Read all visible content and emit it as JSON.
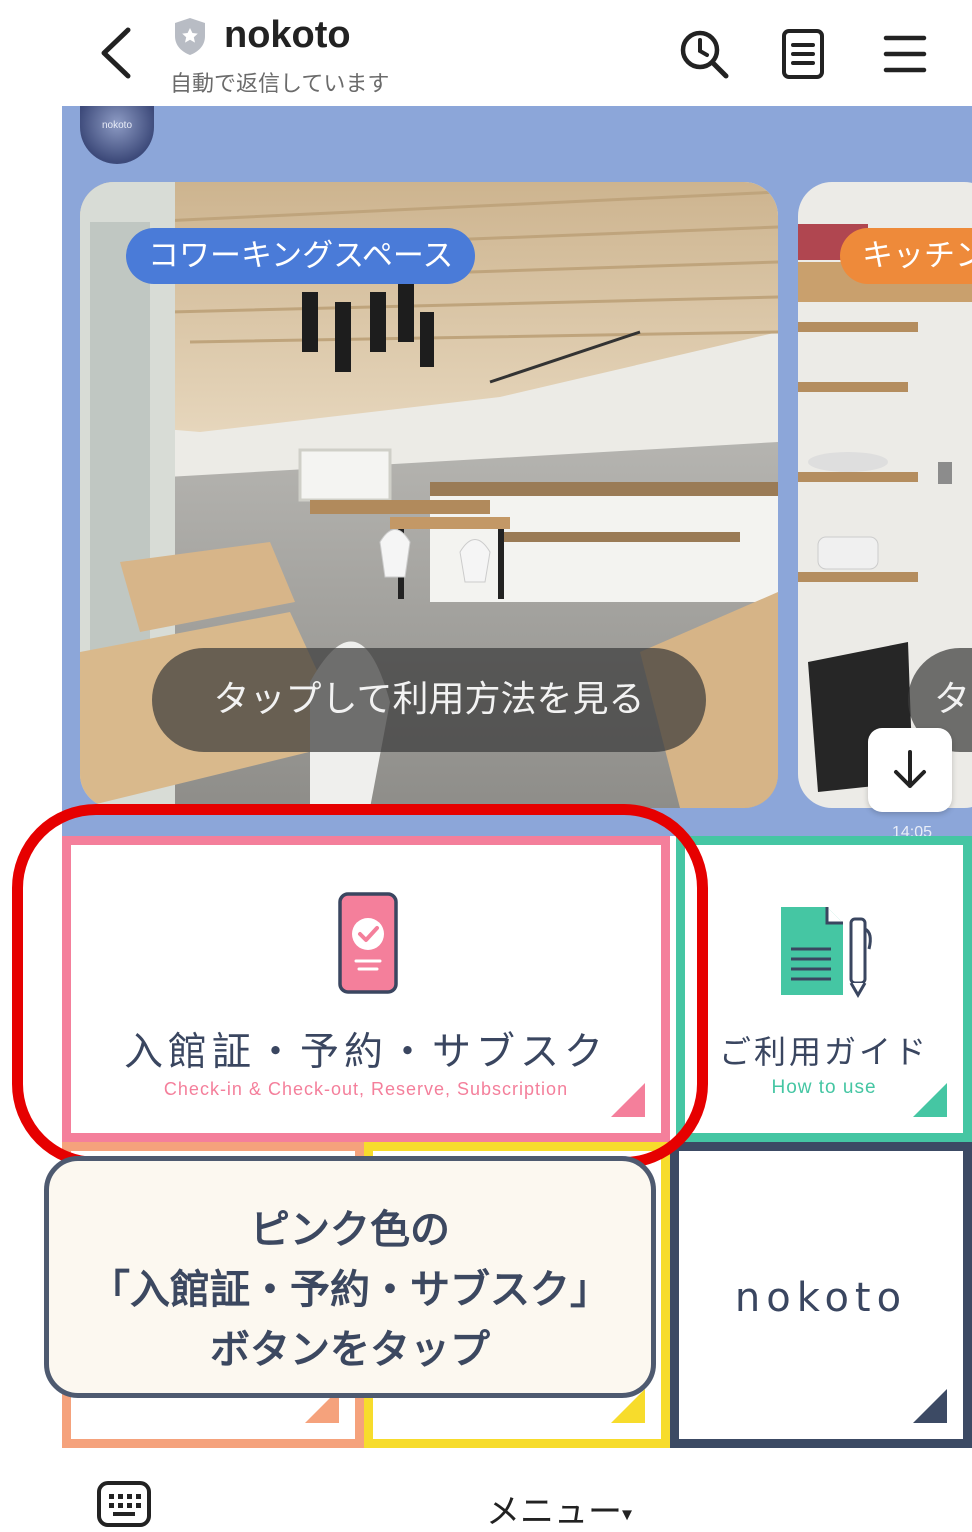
{
  "header": {
    "title": "nokoto",
    "status": "自動で返信しています"
  },
  "chat": {
    "avatar_text": "nokoto",
    "cards": [
      {
        "tag": "コワーキングスペース",
        "action": "タップして利用方法を見る"
      },
      {
        "tag": "キッチン",
        "action": "タ"
      }
    ],
    "time": "14:05"
  },
  "rich_menu": {
    "pink_tile": {
      "title": "入館証・予約・サブスク",
      "subtitle": "Check-in & Check-out, Reserve, Subscription"
    },
    "green_tile": {
      "title": "ご利用ガイド",
      "subtitle": "How to use"
    },
    "navy_tile": {
      "logo": "nokoto"
    }
  },
  "callout": {
    "lines": [
      "ピンク色の",
      "「入館証・予約・サブスク」",
      "ボタンをタップ"
    ]
  },
  "bottom_bar": {
    "menu_label": "メニュー",
    "menu_caret": "▾"
  },
  "colors": {
    "chat_bg": "#8ca6d9",
    "pink": "#f47f9b",
    "green": "#45c6a3",
    "salmon": "#f5a27c",
    "yellow": "#f7dc2c",
    "navy": "#3c4a64",
    "highlight_red": "#e60000",
    "tag_blue": "#4a7bd8",
    "tag_orange": "#ee8a3a"
  }
}
